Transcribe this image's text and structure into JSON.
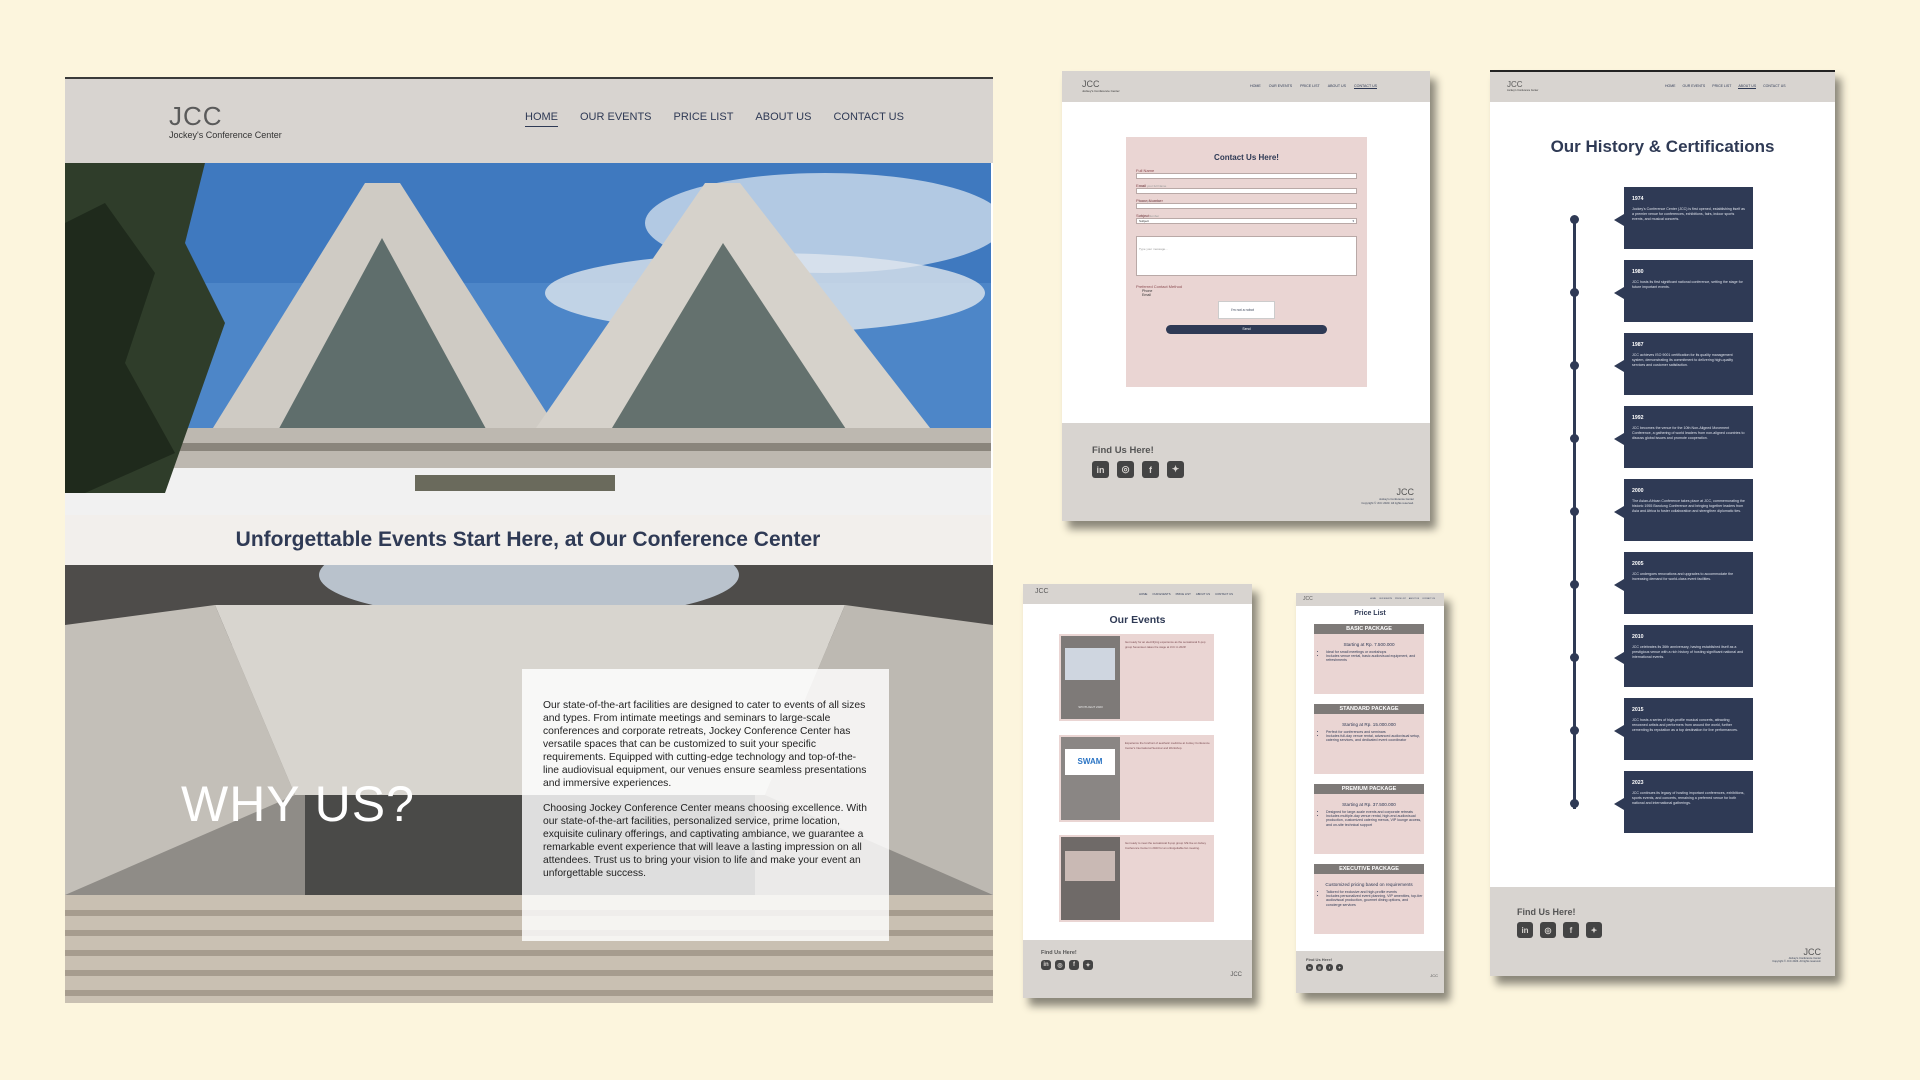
{
  "home": {
    "logo": "JCC",
    "logo_sub": "Jockey's Conference Center",
    "nav": [
      "HOME",
      "OUR EVENTS",
      "PRICE LIST",
      "ABOUT US",
      "CONTACT US"
    ],
    "tagline": "Unforgettable Events Start Here, at Our Conference Center",
    "why_title": "WHY US?",
    "why_p1": "Our state-of-the-art facilities are designed to cater to events of all sizes and types. From intimate meetings and seminars to large-scale conferences and corporate retreats, Jockey Conference Center has versatile spaces that can be customized to suit your specific requirements. Equipped with cutting-edge technology and top-of-the-line audiovisual equipment, our venues ensure seamless presentations and immersive experiences.",
    "why_p2": "Choosing Jockey Conference Center means choosing excellence. With our state-of-the-art facilities, personalized service, prime location, exquisite culinary offerings, and captivating ambiance, we guarantee a remarkable event experience that will leave a lasting impression on all attendees. Trust us to bring your vision to life and make your event an unforgettable success."
  },
  "contact": {
    "logo": "JCC",
    "logo_sub": "Jockey's Conference Center",
    "nav": [
      "HOME",
      "OUR EVENTS",
      "PRICE LIST",
      "ABOUT US",
      "CONTACT US"
    ],
    "title": "Contact Us Here!",
    "fields": [
      {
        "label": "Full Name",
        "placeholder": "Enter your full Name"
      },
      {
        "label": "Email",
        "placeholder": "Enter your email"
      },
      {
        "label": "Phone Number",
        "placeholder": "Phone Number"
      }
    ],
    "subject_label": "Subject",
    "subject_value": "Subject",
    "message_placeholder": "Type your message...",
    "pref_label": "Preferred Contact Method",
    "pref_options": [
      "Phone",
      "Email"
    ],
    "captcha": "I'm not a robot",
    "send": "Send",
    "footer_title": "Find Us Here!",
    "footer_logo": "JCC",
    "footer_sub": "Jockey's Conference Center",
    "copyright": "Copyright © JCC 2023. All rights reserved."
  },
  "events": {
    "logo": "JCC",
    "nav": [
      "HOME",
      "OUR EVENTS",
      "PRICE LIST",
      "ABOUT US",
      "CONTACT US"
    ],
    "title": "Our Events",
    "items": [
      {
        "caption": "SPOTLIGHT 2023",
        "text": "Get ready for an electrifying experience as the sensational K-pop group Seventeen takes the stage at JCC in 2023!"
      },
      {
        "caption": "SWAM",
        "text": "Experience the forefront of aesthetic medicine at Jockey Conference Center's International Seminar and Workshop."
      },
      {
        "caption": "",
        "text": "Get ready to meet the sensational K-pop group IVE live at Jockey Conference Center in 2023 for an unforgettable fan meeting."
      }
    ],
    "footer_title": "Find Us Here!",
    "footer_logo": "JCC"
  },
  "price": {
    "logo": "JCC",
    "nav": [
      "HOME",
      "OUR EVENTS",
      "PRICE LIST",
      "ABOUT US",
      "CONTACT US"
    ],
    "title": "Price List",
    "packages": [
      {
        "name": "BASIC PACKAGE",
        "start": "Starting at Rp. 7.500.000",
        "items": [
          "Ideal for small meetings or workshops",
          "Includes venue rental, basic audiovisual equipment, and refreshments"
        ]
      },
      {
        "name": "STANDARD PACKAGE",
        "start": "Starting at Rp. 15.000.000",
        "items": [
          "Perfect for conferences and seminars",
          "Includes full-day venue rental, advanced audiovisual setup, catering services, and dedicated event coordinator"
        ]
      },
      {
        "name": "PREMIUM PACKAGE",
        "start": "Starting at Rp. 37.500.000",
        "items": [
          "Designed for large-scale events and corporate retreats",
          "Includes multiple-day venue rental, high-end audiovisual production, customized catering menus, VIP lounge access, and on-site technical support"
        ]
      },
      {
        "name": "EXECUTIVE PACKAGE",
        "start": "Customized pricing based on requirements",
        "items": [
          "Tailored for exclusive and high-profile events",
          "Includes personalized event planning, VIP amenities, top-tier audiovisual production, gourmet dining options, and concierge services"
        ]
      }
    ],
    "footer_title": "Find Us Here!",
    "footer_logo": "JCC"
  },
  "history": {
    "logo": "JCC",
    "logo_sub": "Jockey's Conference Center",
    "nav": [
      "HOME",
      "OUR EVENTS",
      "PRICE LIST",
      "ABOUT US",
      "CONTACT US"
    ],
    "title": "Our History & Certifications",
    "milestones": [
      {
        "year": "1974",
        "text": "Jockey's Conference Center (JCC) is first opened, establishing itself as a premier venue for conferences, exhibitions, fairs, indoor sports events, and musical concerts."
      },
      {
        "year": "1980",
        "text": "JCC hosts its first significant national conference, setting the stage for future important events."
      },
      {
        "year": "1987",
        "text": "JCC achieves ISO 9001 certification for its quality management system, demonstrating its commitment to delivering high-quality services and customer satisfaction."
      },
      {
        "year": "1992",
        "text": "JCC becomes the venue for the 10th Non-Aligned Movement Conference, a gathering of world leaders from non-aligned countries to discuss global issues and promote cooperation."
      },
      {
        "year": "2000",
        "text": "The Asian-African Conference takes place at JCC, commemorating the historic 1955 Bandung Conference and bringing together leaders from Asia and Africa to foster collaboration and strengthen diplomatic ties."
      },
      {
        "year": "2005",
        "text": "JCC undergoes renovations and upgrades to accommodate the increasing demand for world-class event facilities."
      },
      {
        "year": "2010",
        "text": "JCC celebrates its 36th anniversary, having established itself as a prestigious venue with a rich history of hosting significant national and international events."
      },
      {
        "year": "2015",
        "text": "JCC hosts a series of high-profile musical concerts, attracting renowned artists and performers from around the world, further cementing its reputation as a top destination for live performances."
      },
      {
        "year": "2023",
        "text": "JCC continues its legacy of hosting important conferences, exhibitions, sports events, and concerts, remaining a preferred venue for both national and international gatherings."
      }
    ],
    "footer_title": "Find Us Here!",
    "footer_logo": "JCC",
    "footer_sub": "Jockey's Conference Center",
    "copyright": "Copyright © JCC 2023. All rights reserved."
  },
  "social_icons": [
    "linkedin-icon",
    "instagram-icon",
    "facebook-icon",
    "twitter-icon"
  ],
  "colors": {
    "background": "#fcf5dd",
    "navy": "#2f3a55",
    "pink": "#ead5d3",
    "header_gray": "#d8d4d0"
  }
}
